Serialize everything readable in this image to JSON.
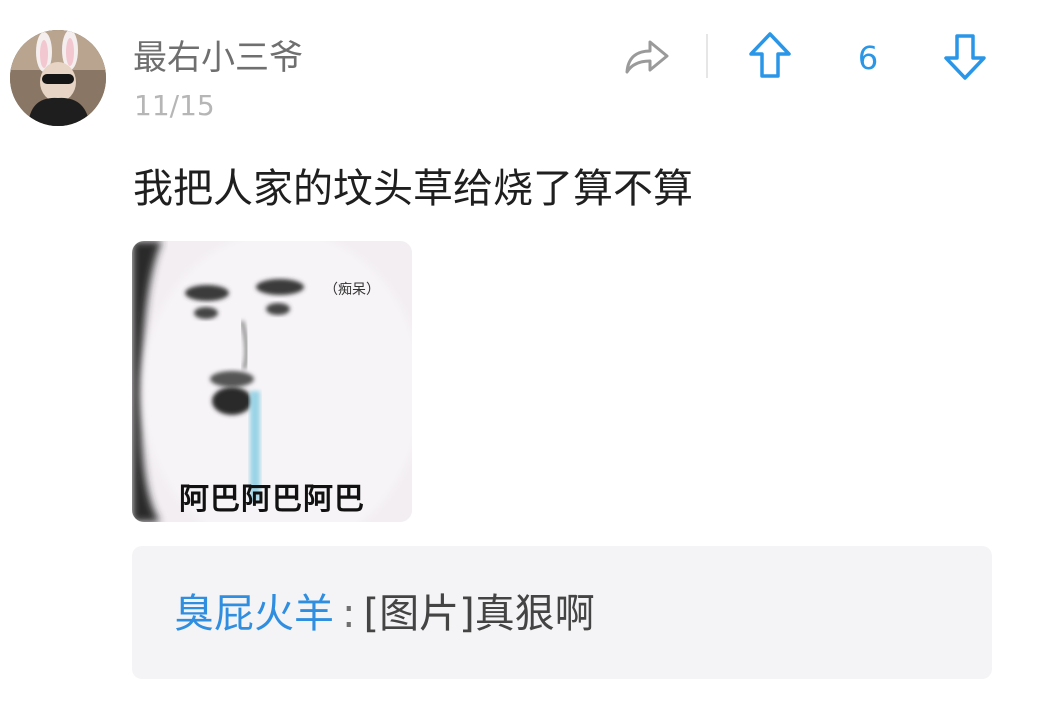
{
  "post": {
    "author": "最右小三爷",
    "date": "11/15",
    "text": "我把人家的坟头草给烧了算不算",
    "vote_count": "6",
    "icons": {
      "share": "share-arrow-icon",
      "upvote": "arrow-up-icon",
      "downvote": "arrow-down-icon"
    },
    "image": {
      "tag": "（痴呆）",
      "caption": "阿巴阿巴阿巴"
    }
  },
  "comment": {
    "author": "臭屁火羊",
    "separator": ":",
    "text": "[图片]真狠啊"
  },
  "colors": {
    "accent": "#2a96e8",
    "username": "#6f6f6f",
    "date": "#b6b6b6",
    "comment_bg": "#f4f4f6"
  }
}
